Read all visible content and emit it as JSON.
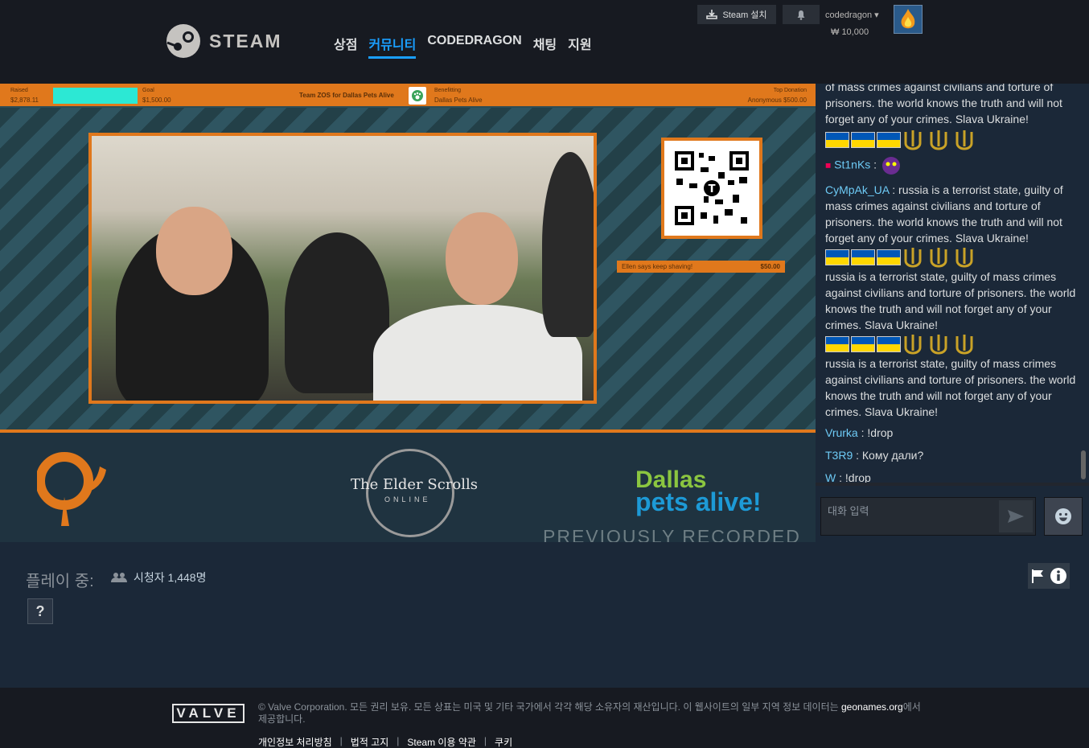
{
  "header": {
    "logo_text": "STEAM",
    "nav": [
      "상점",
      "커뮤니티",
      "CODEDRAGON",
      "채팅",
      "지원"
    ],
    "active_nav": 1,
    "install_label": "Steam 설치",
    "username": "codedragon",
    "wallet": "₩ 10,000",
    "accent": "#1a9fff"
  },
  "stream": {
    "raised_label": "Raised",
    "raised_value": "$2,878.11",
    "goal_label": "Goal",
    "goal_value": "$1,500.00",
    "team": "Team ZOS for Dallas Pets Alive",
    "benefit_label": "Benefitting",
    "benefit_value": "Dallas Pets Alive",
    "top_label": "Top Donation",
    "top_value": "Anonymous $500.00",
    "donation_msg": "Ellen says keep shaving!",
    "donation_amt": "$50.00",
    "eso_title": "The Elder Scrolls",
    "eso_sub": "ONLINE",
    "dpa_line1": "Dallas",
    "dpa_line2": "pets alive!",
    "watermark": "PREVIOUSLY RECORDED",
    "accent": "#e0781c"
  },
  "chat": {
    "messages": [
      {
        "user": "",
        "text": "of mass crimes against civilians and torture of prisoners. the world knows the truth and will not forget any of your crimes. Slava Ukraine!"
      },
      {
        "user": "St1nKs",
        "text": " :"
      },
      {
        "user": "CyMpAk_UA",
        "text": " : russia is a terrorist state, guilty of mass crimes against civilians and torture of prisoners. the world knows the truth and will not forget any of your crimes. Slava Ukraine!"
      },
      {
        "user": "",
        "text": "russia is a terrorist state, guilty of mass crimes against civilians and torture of prisoners. the world knows the truth and will not forget any of your crimes. Slava Ukraine!"
      },
      {
        "user": "",
        "text": "russia is a terrorist state, guilty of mass crimes against civilians and torture of prisoners. the world knows the truth and will not forget any of your crimes. Slava Ukraine!"
      },
      {
        "user": "Vrurka",
        "text": " : !drop"
      },
      {
        "user": "T3R9",
        "text": " : Кому дали?"
      },
      {
        "user": "W",
        "text": " : !drop"
      }
    ],
    "input_placeholder": "대화 입력"
  },
  "below": {
    "playing_label": "플레이 중:",
    "viewers": "시청자 1,448명",
    "game_placeholder": "?"
  },
  "footer": {
    "logo": "VALVE",
    "copyright": "© Valve Corporation. 모든 권리 보유. 모든 상표는 미국 및 기타 국가에서 각각 해당 소유자의 재산입니다. 이 웹사이트의 일부 지역 정보 데이터는",
    "geo_link": "geonames.org",
    "copyright_end": "에서 제공합니다.",
    "links": [
      "개인정보 처리방침",
      "법적 고지",
      "Steam 이용 약관",
      "쿠키"
    ]
  }
}
